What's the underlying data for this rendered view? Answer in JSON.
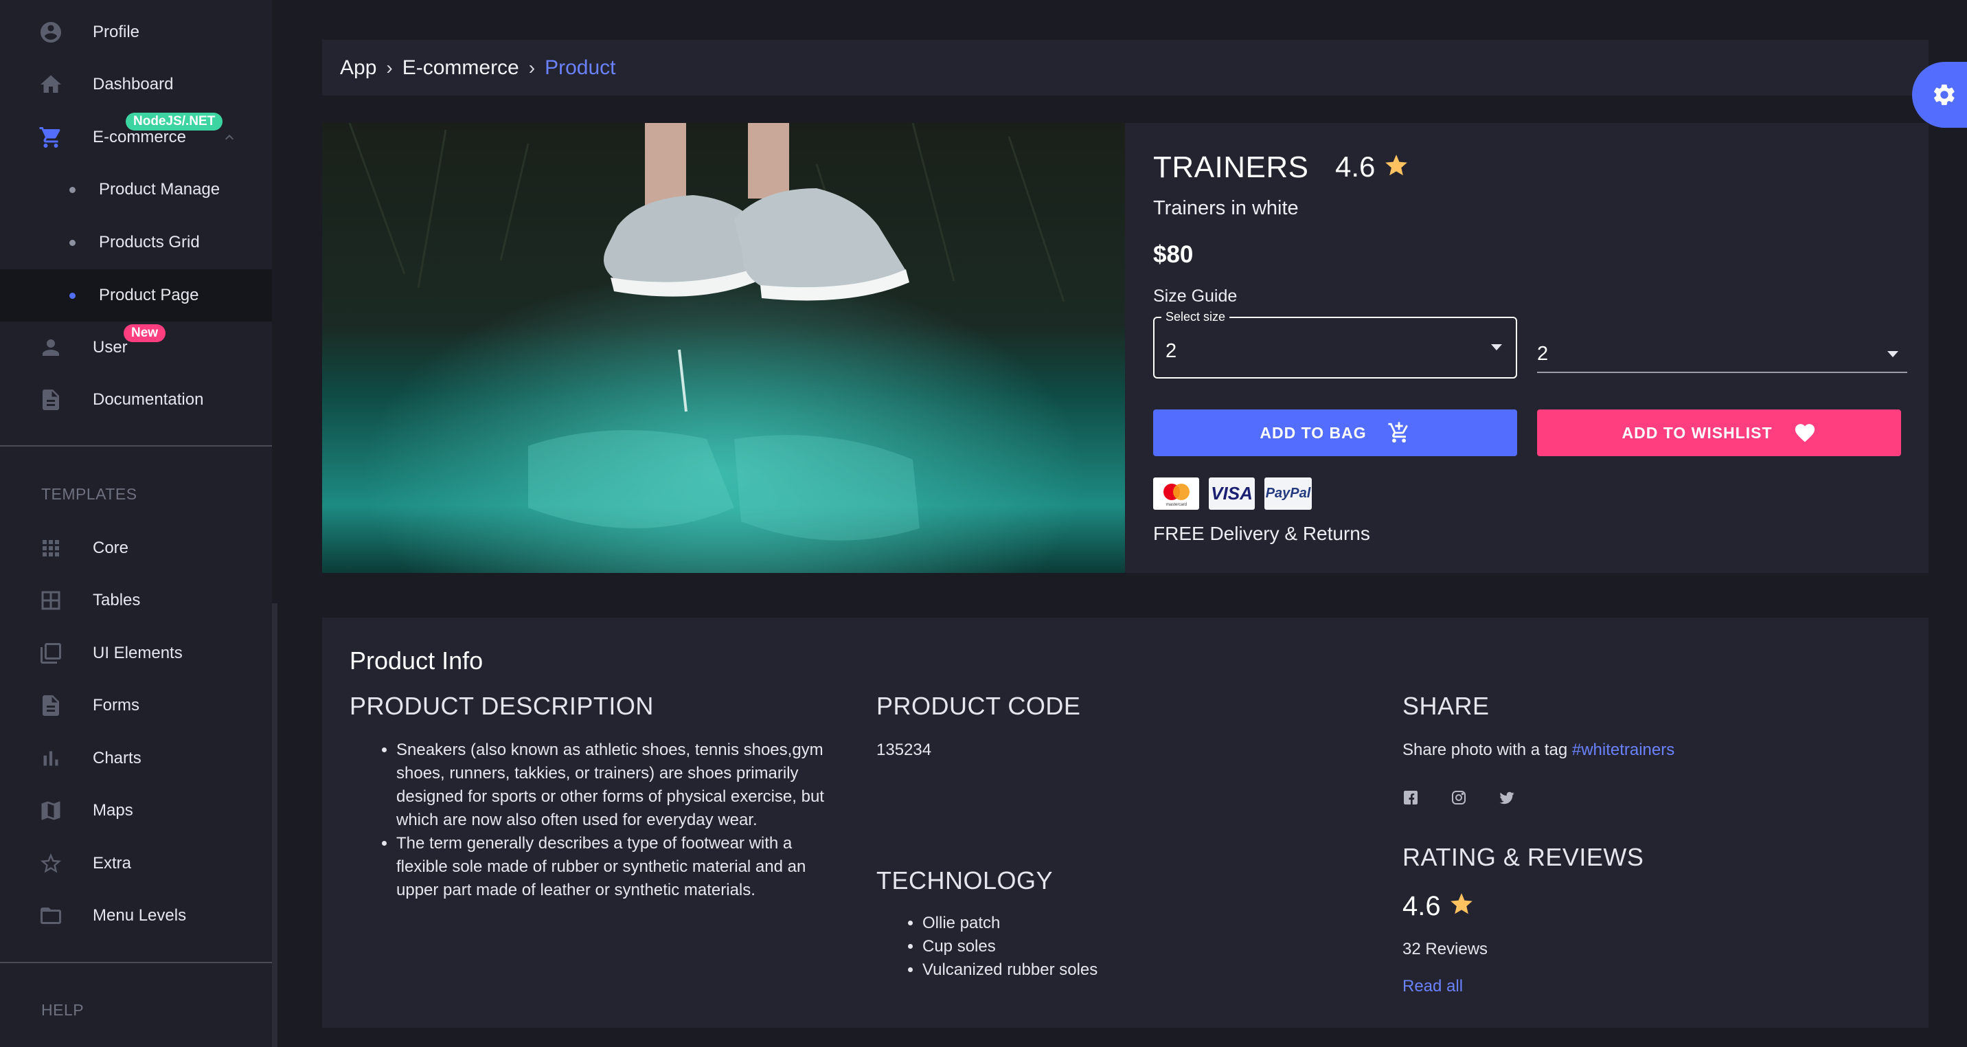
{
  "sidebar": {
    "items": [
      {
        "label": "Profile",
        "icon": "account-circle-icon"
      },
      {
        "label": "Dashboard",
        "icon": "home-icon"
      },
      {
        "label": "E-commerce",
        "icon": "shopping-cart-icon",
        "badge": "NodeJS/.NET",
        "badge_color": "#3cd4a0"
      },
      {
        "label": "Product Manage"
      },
      {
        "label": "Products Grid"
      },
      {
        "label": "Product Page"
      },
      {
        "label": "User",
        "icon": "person-icon",
        "badge": "New",
        "badge_color": "#ff3e7f"
      },
      {
        "label": "Documentation",
        "icon": "document-icon"
      }
    ],
    "templates_heading": "TEMPLATES",
    "templates": [
      {
        "label": "Core",
        "icon": "grid-icon"
      },
      {
        "label": "Tables",
        "icon": "table-icon"
      },
      {
        "label": "UI Elements",
        "icon": "library-icon"
      },
      {
        "label": "Forms",
        "icon": "form-icon"
      },
      {
        "label": "Charts",
        "icon": "bar-chart-icon"
      },
      {
        "label": "Maps",
        "icon": "map-icon"
      },
      {
        "label": "Extra",
        "icon": "star-outline-icon"
      },
      {
        "label": "Menu Levels",
        "icon": "folder-icon"
      }
    ],
    "help_heading": "HELP"
  },
  "breadcrumb": {
    "items": [
      "App",
      "E-commerce",
      "Product"
    ]
  },
  "product": {
    "title": "TRAINERS",
    "rating": "4.6",
    "subtitle": "Trainers in white",
    "price": "$80",
    "size_guide": "Size Guide",
    "select_label": "Select size",
    "select_value": "2",
    "select2_value": "2",
    "add_to_bag": "ADD TO BAG",
    "add_to_wishlist": "ADD TO WISHLIST",
    "payments": [
      "mastercard",
      "VISA",
      "PayPal"
    ],
    "delivery": "FREE Delivery & Returns"
  },
  "info": {
    "title": "Product Info",
    "description_heading": "PRODUCT DESCRIPTION",
    "description": [
      "Sneakers (also known as athletic shoes, tennis shoes,gym shoes, runners, takkies, or trainers) are shoes primarily designed for sports or other forms of physical exercise, but which are now also often used for everyday wear.",
      "The term generally describes a type of footwear with a flexible sole made of rubber or synthetic material and an upper part made of leather or synthetic materials."
    ],
    "code_heading": "PRODUCT CODE",
    "code": "135234",
    "technology_heading": "TECHNOLOGY",
    "technology": [
      "Ollie patch",
      "Cup soles",
      "Vulcanized rubber soles"
    ],
    "share_heading": "SHARE",
    "share_text": "Share photo with a tag",
    "share_tag": "#whitetrainers",
    "reviews_heading": "RATING & REVIEWS",
    "reviews_rating": "4.6",
    "reviews_count": "32 Reviews",
    "read_all": "Read all"
  },
  "colors": {
    "accent": "#536dfe",
    "wishlist": "#ff3e7f",
    "star": "#ffc260",
    "background": "#1b1c23",
    "card": "#23242f"
  }
}
